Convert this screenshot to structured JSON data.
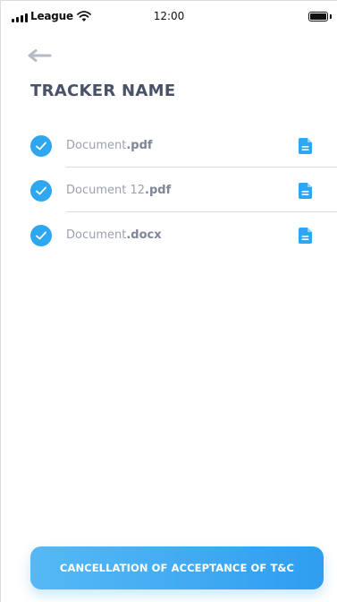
{
  "status_bar": {
    "carrier": "League",
    "time": "12:00",
    "signal_icon": "signal-bars-icon",
    "wifi_icon": "wifi-icon",
    "battery_icon": "battery-icon",
    "battery_level": 1.0
  },
  "header": {
    "back_icon": "arrow-left-icon",
    "title": "TRACKER NAME"
  },
  "documents": [
    {
      "name": "Document",
      "extension": ".pdf",
      "checked": true,
      "icon": "file-icon"
    },
    {
      "name": "Document 12",
      "extension": ".pdf",
      "checked": true,
      "icon": "file-icon"
    },
    {
      "name": "Document",
      "extension": ".docx",
      "checked": true,
      "icon": "file-icon"
    }
  ],
  "footer": {
    "button_label": "CANCELLATION OF ACCEPTANCE OF T&C"
  },
  "colors": {
    "accent": "#2fa6f0",
    "title": "#4a5268",
    "muted_text": "#9aa1b3",
    "back_arrow": "#b5bac7"
  }
}
